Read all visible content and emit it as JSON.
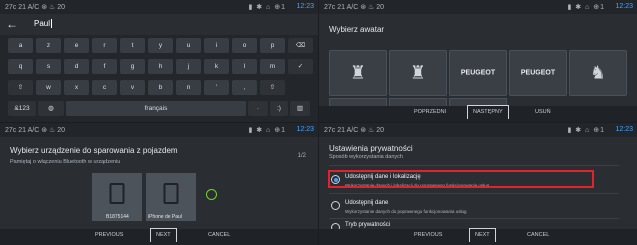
{
  "status_bar": {
    "left": "27c  21 A/C  ⊛  ♨ 20",
    "icons": "▮ ✱ ⌂ ⊕1",
    "clock": "12:23"
  },
  "keyboard_screen": {
    "input_value": "Paul",
    "keys_row1": [
      "a",
      "z",
      "e",
      "r",
      "t",
      "y",
      "u",
      "i",
      "o",
      "p",
      "⌫"
    ],
    "keys_row2": [
      "q",
      "s",
      "d",
      "f",
      "g",
      "h",
      "j",
      "k",
      "l",
      "m",
      "✓"
    ],
    "keys_row3": [
      "⇧",
      "w",
      "x",
      "c",
      "v",
      "b",
      "n",
      "'",
      ",",
      "⇧"
    ],
    "sym_key": "&123",
    "globe_key": "◍",
    "space_label": "français",
    "key_dot": "·",
    "key_special": ":)",
    "key_hide": "▥"
  },
  "avatar_screen": {
    "title": "Wybierz awatar",
    "brands": [
      {
        "kind": "emblem",
        "glyph": "♜"
      },
      {
        "kind": "emblem",
        "glyph": "♜"
      },
      {
        "kind": "text",
        "text": "PEUGEOT"
      },
      {
        "kind": "text",
        "text": "PEUGEOT"
      },
      {
        "kind": "emblem",
        "glyph": "♞"
      }
    ],
    "buttons": {
      "prev": "POPRZEDNI",
      "next": "NASTĘPNY",
      "delete": "USUŃ"
    }
  },
  "pair_screen": {
    "title": "Wybierz urządzenie do sparowania z pojazdem",
    "subtitle": "Pamiętaj o włączeniu Bluetooth w urządzeniu",
    "pager": "1/2",
    "devices": [
      {
        "name": "B1875144"
      },
      {
        "name": "iPhone de Paul"
      }
    ],
    "buttons": {
      "prev": "PREVIOUS",
      "next": "NEXT",
      "cancel": "CANCEL"
    }
  },
  "privacy_screen": {
    "title": "Ustawienia prywatności",
    "subtitle": "Sposób wykorzystania danych",
    "options": [
      {
        "title": "Udostępnij dane i lokalizację",
        "desc": "Wykorzystanie danych i lokalizacji do poprawnego funkcjonowania usług",
        "selected": true
      },
      {
        "title": "Udostępnij dane",
        "desc": "Wykorzystanie danych do poprawnego funkcjonowania usług",
        "selected": false
      },
      {
        "title": "Tryb prywatności",
        "desc": "",
        "selected": false
      }
    ],
    "buttons": {
      "prev": "PREVIOUS",
      "next": "NEXT",
      "cancel": "CANCEL"
    },
    "highlight_color": "#e3232b",
    "accent": "#44a4ff"
  }
}
